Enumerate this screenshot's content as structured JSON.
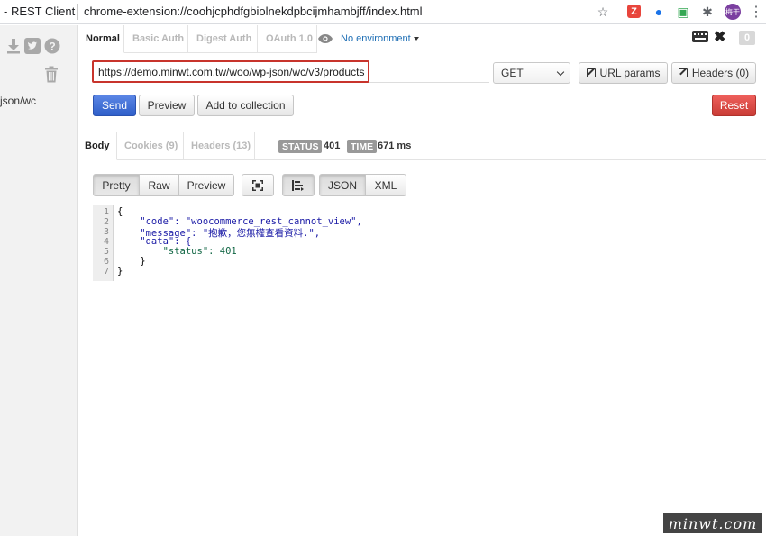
{
  "window": {
    "app_title": "- REST Client",
    "extension_url": "chrome-extension://coohjcphdfgbiolnekdpbcijmhambjff/index.html",
    "avatar_text": "梅干"
  },
  "toolbar_icons": {
    "bookmark": "star-icon",
    "extension_z": "Z",
    "extensions": "puzzle-icon",
    "menu": "kebab-menu-icon"
  },
  "sidebar": {
    "icons": [
      "download-icon",
      "twitter-icon",
      "help-icon",
      "trash-icon"
    ],
    "history_item": "json/wc"
  },
  "auth_tabs": [
    {
      "label": "Normal",
      "active": true
    },
    {
      "label": "Basic Auth",
      "active": false
    },
    {
      "label": "Digest Auth",
      "active": false
    },
    {
      "label": "OAuth 1.0",
      "active": false
    }
  ],
  "environment": {
    "label": "No environment"
  },
  "header_right": {
    "count_badge": "0"
  },
  "request": {
    "url": "https://demo.minwt.com.tw/woo/wp-json/wc/v3/products",
    "method": "GET",
    "url_params_label": "URL params",
    "headers_label": "Headers (0)",
    "send_label": "Send",
    "preview_label": "Preview",
    "add_collection_label": "Add to collection",
    "reset_label": "Reset"
  },
  "response_tabs": [
    {
      "label": "Body",
      "active": true
    },
    {
      "label": "Cookies (9)",
      "active": false
    },
    {
      "label": "Headers (13)",
      "active": false
    }
  ],
  "response_status": {
    "status_label": "STATUS",
    "status_value": "401",
    "time_label": "TIME",
    "time_value": "671 ms"
  },
  "view_buttons": {
    "pretty": "Pretty",
    "raw": "Raw",
    "preview": "Preview",
    "json": "JSON",
    "xml": "XML"
  },
  "code_lines": [
    {
      "num": "1",
      "text": "{"
    },
    {
      "num": "2",
      "text": "    \"code\": \"woocommerce_rest_cannot_view\","
    },
    {
      "num": "3",
      "text": "    \"message\": \"抱歉，您無權查看資料.\","
    },
    {
      "num": "4",
      "text": "    \"data\": {"
    },
    {
      "num": "5",
      "text": "        \"status\": 401"
    },
    {
      "num": "6",
      "text": "    }"
    },
    {
      "num": "7",
      "text": "}"
    }
  ],
  "watermark": "minwt.com",
  "colors": {
    "send": "#3a66d2",
    "reset": "#da4a44",
    "url_highlight": "#c8342c",
    "link": "#1f6fb5"
  }
}
